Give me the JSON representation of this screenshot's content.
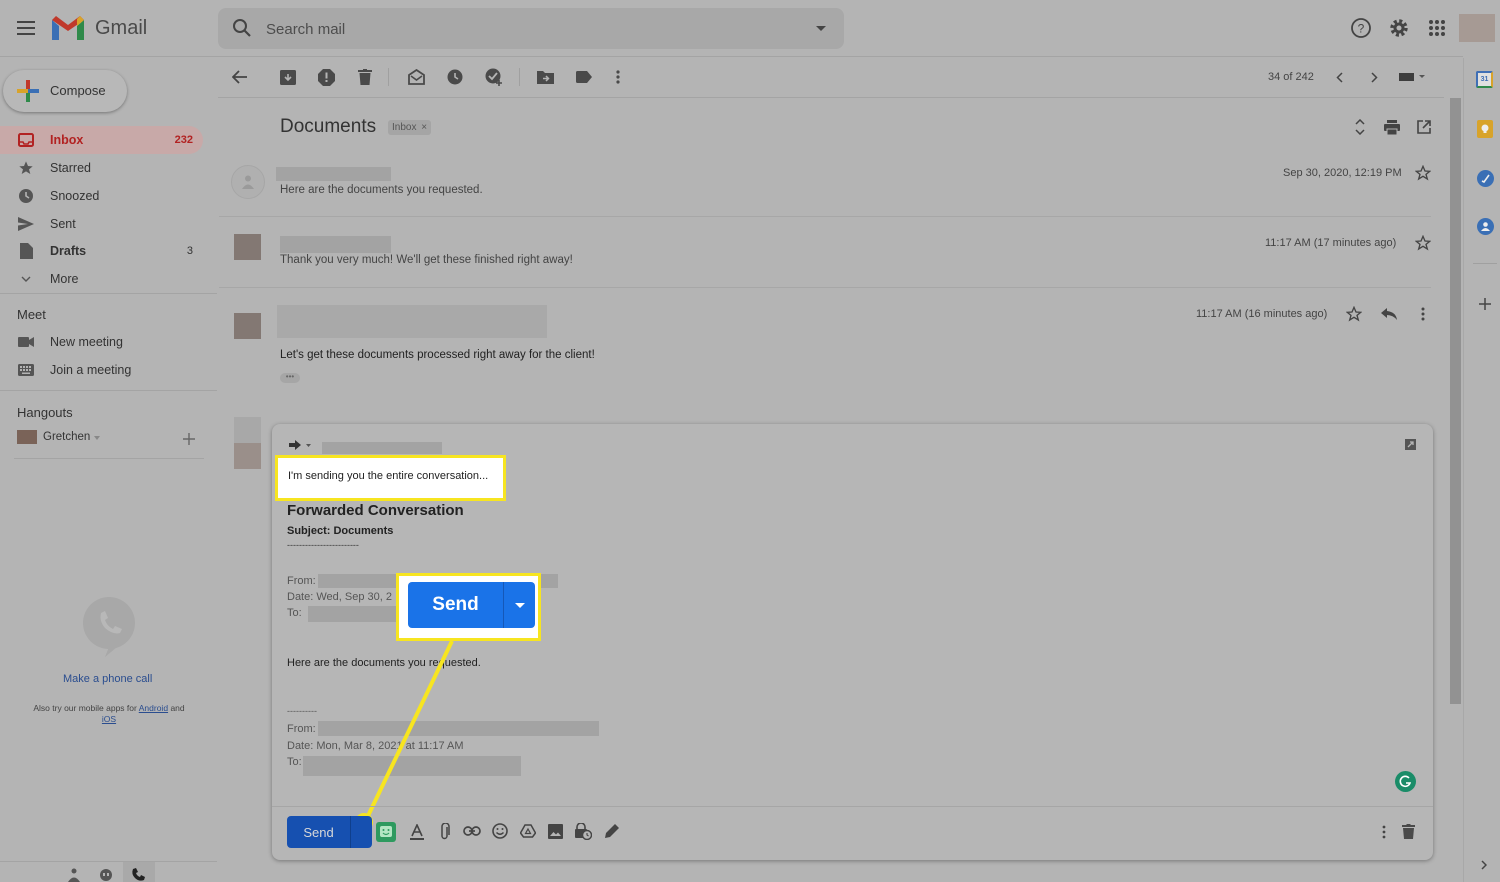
{
  "app": {
    "brand": "Gmail"
  },
  "search": {
    "placeholder": "Search mail"
  },
  "compose_label": "Compose",
  "sidebar": {
    "items": [
      {
        "label": "Inbox",
        "count": "232",
        "icon": "inbox-icon"
      },
      {
        "label": "Starred",
        "count": "",
        "icon": "star-icon"
      },
      {
        "label": "Snoozed",
        "count": "",
        "icon": "clock-icon"
      },
      {
        "label": "Sent",
        "count": "",
        "icon": "send-icon"
      },
      {
        "label": "Drafts",
        "count": "3",
        "icon": "draft-icon"
      },
      {
        "label": "More",
        "count": "",
        "icon": "chevron-down-icon"
      }
    ],
    "meet": {
      "title": "Meet",
      "items": [
        "New meeting",
        "Join a meeting"
      ]
    },
    "hangouts": {
      "title": "Hangouts",
      "user": "Gretchen"
    },
    "phone": {
      "link": "Make a phone call",
      "apps_pre": "Also try our mobile apps for",
      "android": "Android",
      "and": "and",
      "ios": "iOS"
    }
  },
  "toolbar": {
    "pager": "34 of 242"
  },
  "thread": {
    "subject": "Documents",
    "label_chip": "Inbox",
    "messages": [
      {
        "snippet": "Here are the documents you requested.",
        "time": "Sep 30, 2020, 12:19 PM"
      },
      {
        "snippet": "Thank you very much! We'll get these finished right away!",
        "time": "11:17 AM (17 minutes ago)"
      },
      {
        "snippet": "Let's get these documents processed right away for the client!",
        "time": "11:17 AM (16 minutes ago)"
      }
    ]
  },
  "draft": {
    "intro": "I'm sending you the entire conversation...",
    "heading": "Forwarded Conversation",
    "subject_line": "Subject: Documents",
    "sep1": "------------------------",
    "from1": "From:",
    "date1": "Date: Wed, Sep 30, 2",
    "to1": "To:",
    "body1": "Here are the documents you requested.",
    "sep2": "----------",
    "from2": "From:",
    "date2": "Date: Mon, Mar 8, 2021 at 11:17 AM",
    "to2": "To:",
    "send_label": "Send",
    "callout_send_label": "Send"
  },
  "colors": {
    "accent": "#1a73e8",
    "highlight": "#f7e520",
    "inbox_active": "#b22222"
  }
}
